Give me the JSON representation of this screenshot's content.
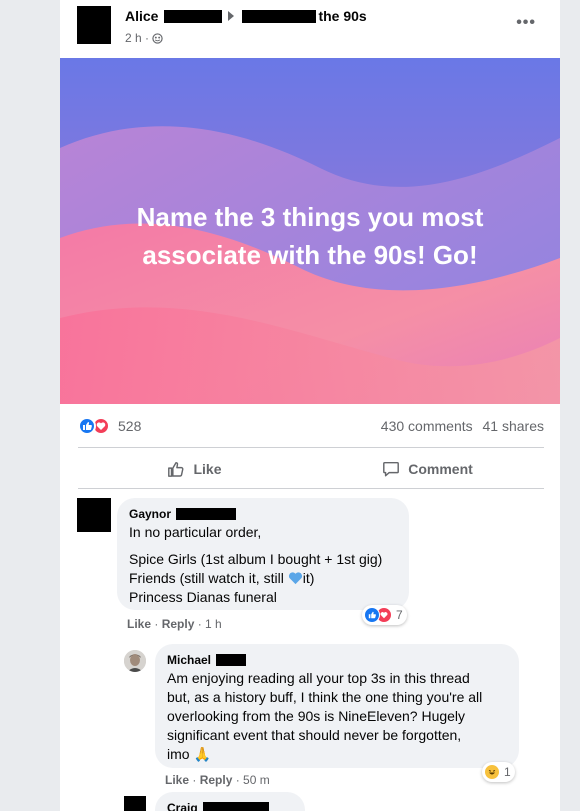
{
  "post": {
    "author": "Alice",
    "group": "the 90s",
    "time": "2 h ·",
    "more": "•••",
    "banner_text": "Name the 3 things you most associate with the 90s! Go!",
    "reaction_count": "528",
    "comments_count": "430 comments",
    "shares_count": "41 shares",
    "like_label": "Like",
    "comment_label": "Comment"
  },
  "comments": [
    {
      "author": "Gaynor",
      "line1": "In no particular order,",
      "line2": "Spice Girls (1st album I bought + 1st gig)",
      "line3a": "Friends (still watch it, still ",
      "line3b": "it)",
      "line4": "Princess Dianas funeral",
      "like": "Like",
      "reply": "Reply",
      "time": "1 h",
      "reactions": "7"
    },
    {
      "author": "Michael",
      "text_lines": [
        "Am enjoying reading all your top 3s in this thread",
        "but, as a history buff, I think the one thing you're all",
        "overlooking from the 90s is NineEleven? Hugely",
        "significant event that should never be forgotten,",
        "imo 🙏"
      ],
      "like": "Like",
      "reply": "Reply",
      "time": "50 m",
      "reactions": "1"
    },
    {
      "author": "Craig"
    }
  ],
  "colors": {
    "facebook_blue": "#1877f2",
    "love_red": "#f33e58",
    "banner_top": "#6a7ee8",
    "banner_bottom": "#f6708f"
  }
}
